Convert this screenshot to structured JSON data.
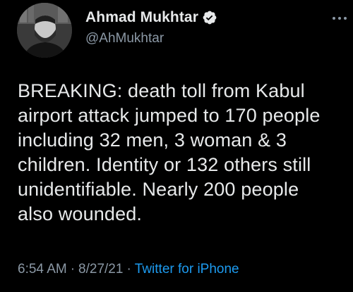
{
  "author": {
    "display_name": "Ahmad Mukhtar",
    "handle": "@AhMukhtar",
    "verified": true,
    "avatar_icon": "profile-photo"
  },
  "tweet": {
    "text": "BREAKING: death toll from Kabul\nairport attack jumped to 170 people\nincluding 32 men, 3 woman & 3\nchildren. Identity or 132 others still\nunidentifiable. Nearly 200 people\nalso wounded."
  },
  "meta": {
    "time": "6:54 AM",
    "separator": "·",
    "date": "8/27/21",
    "source": "Twitter for iPhone"
  },
  "colors": {
    "background": "#000000",
    "text": "#e7e9ea",
    "secondary": "#8b98a5",
    "link": "#1d9bf0"
  },
  "icons": {
    "verified": "verified-badge-icon",
    "more": "more-options-icon"
  }
}
